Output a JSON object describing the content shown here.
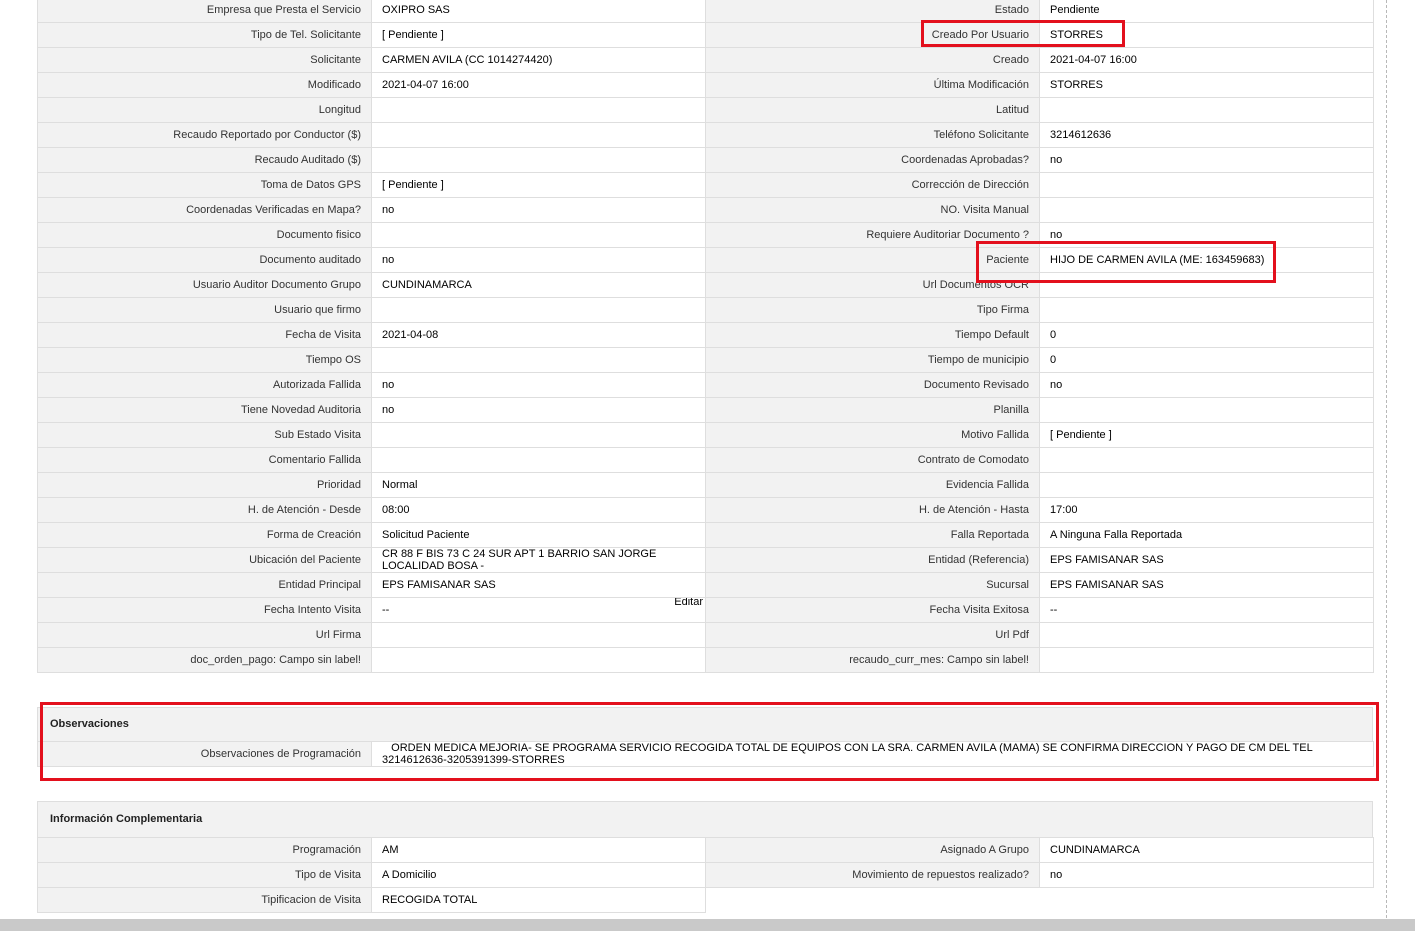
{
  "main_rows": [
    {
      "l1": "Empresa que Presta el Servicio",
      "v1": "OXIPRO SAS",
      "l2": "Estado",
      "v2": "Pendiente"
    },
    {
      "l1": "Tipo de Tel. Solicitante",
      "v1": "[ Pendiente ]",
      "l2": "Creado Por Usuario",
      "v2": "STORRES"
    },
    {
      "l1": "Solicitante",
      "v1": "CARMEN AVILA (CC 1014274420)",
      "l2": "Creado",
      "v2": "2021-04-07 16:00"
    },
    {
      "l1": "Modificado",
      "v1": "2021-04-07 16:00",
      "l2": "Última Modificación",
      "v2": " STORRES"
    },
    {
      "l1": "Longitud",
      "v1": "",
      "l2": "Latitud",
      "v2": ""
    },
    {
      "l1": "Recaudo Reportado por Conductor ($)",
      "v1": "",
      "l2": "Teléfono Solicitante",
      "v2": "3214612636"
    },
    {
      "l1": "Recaudo Auditado ($)",
      "v1": "",
      "l2": "Coordenadas Aprobadas?",
      "v2": " no"
    },
    {
      "l1": "Toma de Datos GPS",
      "v1": "[ Pendiente ]",
      "l2": "Corrección de Dirección",
      "v2": ""
    },
    {
      "l1": "Coordenadas Verificadas en Mapa?",
      "v1": " no",
      "l2": "NO. Visita Manual",
      "v2": ""
    },
    {
      "l1": "Documento fisico",
      "v1": "",
      "l2": "Requiere Auditoriar Documento ?",
      "v2": " no"
    },
    {
      "l1": "Documento auditado",
      "v1": " no",
      "l2": "Paciente",
      "v2": "HIJO DE CARMEN AVILA (ME: 163459683)"
    },
    {
      "l1": "Usuario Auditor Documento Grupo",
      "v1": "CUNDINAMARCA",
      "l2": "Url Documentos OCR",
      "v2": ""
    },
    {
      "l1": "Usuario que firmo",
      "v1": "",
      "l2": "Tipo Firma",
      "v2": ""
    },
    {
      "l1": "Fecha de Visita",
      "v1": " 2021-04-08",
      "l2": "Tiempo Default",
      "v2": "0"
    },
    {
      "l1": "Tiempo OS",
      "v1": "",
      "l2": "Tiempo de municipio",
      "v2": "0"
    },
    {
      "l1": "Autorizada Fallida",
      "v1": " no",
      "l2": "Documento Revisado",
      "v2": " no"
    },
    {
      "l1": "Tiene Novedad Auditoria",
      "v1": " no",
      "l2": "Planilla",
      "v2": ""
    },
    {
      "l1": "Sub Estado Visita",
      "v1": "",
      "l2": "Motivo Fallida",
      "v2": "[ Pendiente ]"
    },
    {
      "l1": "Comentario Fallida",
      "v1": "",
      "l2": "Contrato de Comodato",
      "v2": ""
    },
    {
      "l1": "Prioridad",
      "v1": "Normal",
      "l2": "Evidencia Fallida",
      "v2": ""
    },
    {
      "l1": "H. de Atención - Desde",
      "v1": "08:00",
      "l2": "H. de Atención - Hasta",
      "v2": "17:00"
    },
    {
      "l1": "Forma de Creación",
      "v1": "Solicitud Paciente",
      "l2": "Falla Reportada",
      "v2": "A Ninguna Falla Reportada"
    },
    {
      "l1": "Ubicación del Paciente",
      "v1": "CR 88 F BIS 73 C 24 SUR APT 1 BARRIO SAN JORGE LOCALIDAD BOSA -",
      "l2": "Entidad (Referencia)",
      "v2": "EPS FAMISANAR SAS"
    },
    {
      "l1": "Entidad Principal",
      "v1": "EPS FAMISANAR SAS",
      "l2": "Sucursal",
      "v2": "EPS FAMISANAR SAS"
    },
    {
      "l1": "Fecha Intento Visita",
      "v1": " --",
      "l2": "Fecha Visita Exitosa",
      "v2": " --"
    },
    {
      "l1": "Url Firma",
      "v1": "",
      "l2": "Url Pdf",
      "v2": ""
    },
    {
      "l1": "doc_orden_pago: Campo sin label!",
      "v1": "",
      "l2": "recaudo_curr_mes: Campo sin label!",
      "v2": ""
    }
  ],
  "edit_link": "Editar",
  "observaciones": {
    "title": "Observaciones",
    "label": "Observaciones de Programación",
    "value": "   ORDEN MEDICA MEJORIA- SE PROGRAMA SERVICIO RECOGIDA TOTAL DE EQUIPOS CON LA SRA. CARMEN AVILA (MAMA) SE CONFIRMA DIRECCION Y PAGO DE CM DEL TEL 3214612636-3205391399-STORRES"
  },
  "complementaria": {
    "title": "Información Complementaria",
    "rows": [
      {
        "l1": "Programación",
        "v1": "AM",
        "l2": "Asignado A Grupo",
        "v2": "CUNDINAMARCA"
      },
      {
        "l1": "Tipo de Visita",
        "v1": "A Domicilio",
        "l2": "Movimiento de repuestos realizado?",
        "v2": " no"
      },
      {
        "l1": "Tipificacion de Visita",
        "v1": "RECOGIDA TOTAL"
      }
    ]
  },
  "colors": {
    "highlight": "#e3101d",
    "label_bg": "#f2f2f2",
    "border": "#dedede"
  }
}
